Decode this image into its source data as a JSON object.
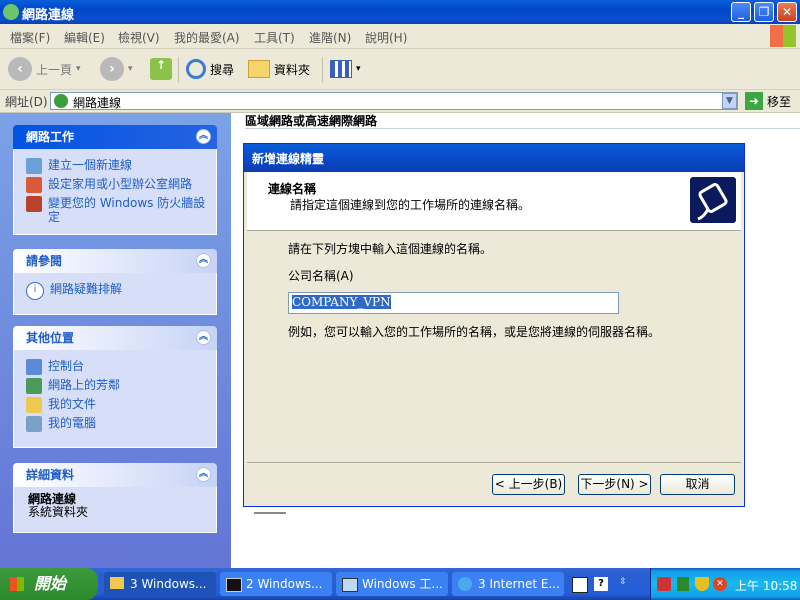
{
  "window": {
    "title": "網路連線"
  },
  "menu": [
    "檔案(F)",
    "編輯(E)",
    "檢視(V)",
    "我的最愛(A)",
    "工具(T)",
    "進階(N)",
    "說明(H)"
  ],
  "toolbar": {
    "back_label": "上一頁",
    "search_label": "搜尋",
    "folders_label": "資料夾"
  },
  "address": {
    "label": "網址(D)",
    "value": "網路連線",
    "go_label": "移至"
  },
  "sidebar": {
    "network_tasks": {
      "title": "網路工作",
      "items": [
        "建立一個新連線",
        "設定家用或小型辦公室網路",
        "變更您的 Windows 防火牆設定"
      ]
    },
    "see_also": {
      "title": "請參閱",
      "items": [
        "網路疑難排解"
      ]
    },
    "other_places": {
      "title": "其他位置",
      "items": [
        "控制台",
        "網路上的芳鄰",
        "我的文件",
        "我的電腦"
      ]
    },
    "details": {
      "title": "詳細資料",
      "name": "網路連線",
      "type": "系統資料夾"
    }
  },
  "content": {
    "section_header": "區域網路或高速網際網路"
  },
  "wizard": {
    "title": "新增連線精靈",
    "header_title": "連線名稱",
    "header_subtitle": "請指定這個連線到您的工作場所的連線名稱。",
    "instruction": "請在下列方塊中輸入這個連線的名稱。",
    "field_label": "公司名稱(A)",
    "field_value": "COMPANY_VPN",
    "example": "例如，您可以輸入您的工作場所的名稱，或是您將連線的伺服器名稱。",
    "back_button": "< 上一步(B)",
    "next_button": "下一步(N) >",
    "cancel_button": "取消"
  },
  "taskbar": {
    "start_label": "開始",
    "tasks": [
      "3 Windows...",
      "2 Windows...",
      "Windows 工...",
      "3 Internet E..."
    ],
    "clock": "上午 10:58"
  }
}
